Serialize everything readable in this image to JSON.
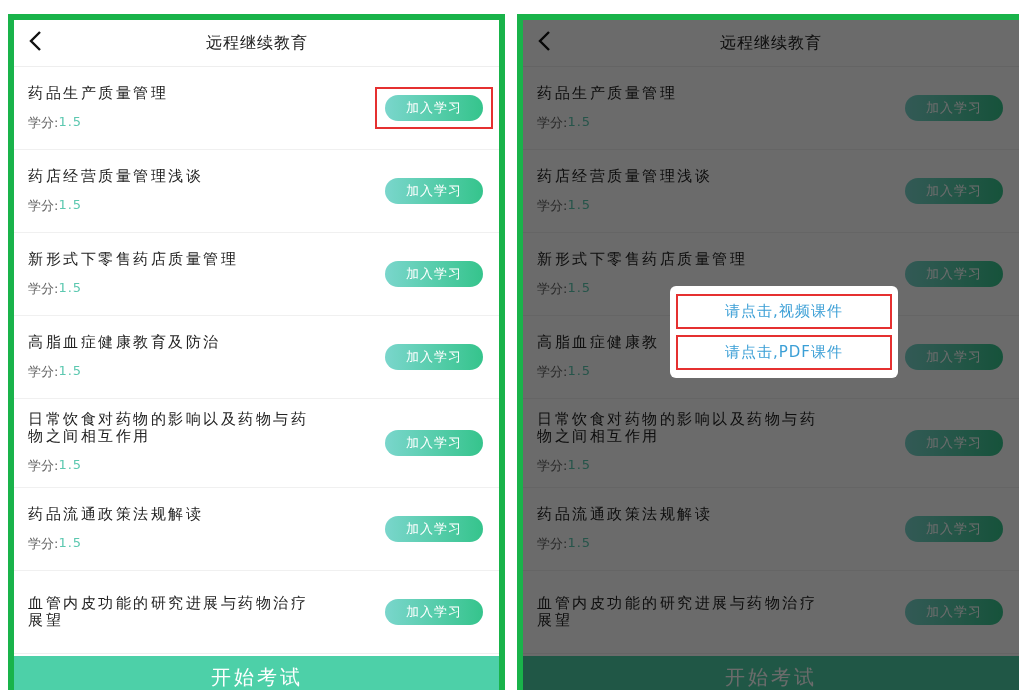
{
  "screens": [
    {
      "title": "远程继续教育",
      "dimmed": false,
      "exam_button": "开始考试",
      "courses": [
        {
          "name": "药品生产质量管理",
          "credit_label": "学分:",
          "credit": "1.5",
          "join_label": "加入学习",
          "highlighted": true
        },
        {
          "name": "药店经营质量管理浅谈",
          "credit_label": "学分:",
          "credit": "1.5",
          "join_label": "加入学习",
          "highlighted": false
        },
        {
          "name": "新形式下零售药店质量管理",
          "credit_label": "学分:",
          "credit": "1.5",
          "join_label": "加入学习",
          "highlighted": false
        },
        {
          "name": "高脂血症健康教育及防治",
          "credit_label": "学分:",
          "credit": "1.5",
          "join_label": "加入学习",
          "highlighted": false
        },
        {
          "name": "日常饮食对药物的影响以及药物与药物之间相互作用",
          "credit_label": "学分:",
          "credit": "1.5",
          "join_label": "加入学习",
          "highlighted": false
        },
        {
          "name": "药品流通政策法规解读",
          "credit_label": "学分:",
          "credit": "1.5",
          "join_label": "加入学习",
          "highlighted": false
        },
        {
          "name": "血管内皮功能的研究进展与药物治疗展望",
          "join_label": "加入学习",
          "highlighted": false
        }
      ]
    },
    {
      "title": "远程继续教育",
      "dimmed": true,
      "exam_button": "开始考试",
      "courses": [
        {
          "name": "药品生产质量管理",
          "credit_label": "学分:",
          "credit": "1.5",
          "join_label": "加入学习",
          "highlighted": false
        },
        {
          "name": "药店经营质量管理浅谈",
          "credit_label": "学分:",
          "credit": "1.5",
          "join_label": "加入学习",
          "highlighted": false
        },
        {
          "name": "新形式下零售药店质量管理",
          "credit_label": "学分:",
          "credit": "1.5",
          "join_label": "加入学习",
          "highlighted": false
        },
        {
          "name": "高脂血症健康教",
          "credit_label": "学分:",
          "credit": "1.5",
          "join_label": "加入学习",
          "highlighted": false
        },
        {
          "name": "日常饮食对药物的影响以及药物与药物之间相互作用",
          "credit_label": "学分:",
          "credit": "1.5",
          "join_label": "加入学习",
          "highlighted": false
        },
        {
          "name": "药品流通政策法规解读",
          "credit_label": "学分:",
          "credit": "1.5",
          "join_label": "加入学习",
          "highlighted": false
        },
        {
          "name": "血管内皮功能的研究进展与药物治疗展望",
          "join_label": "加入学习",
          "highlighted": false
        }
      ],
      "popup": {
        "options": [
          {
            "label": "请点击,视频课件",
            "highlighted": true
          },
          {
            "label": "请点击,PDF课件",
            "highlighted": true
          }
        ]
      }
    }
  ]
}
